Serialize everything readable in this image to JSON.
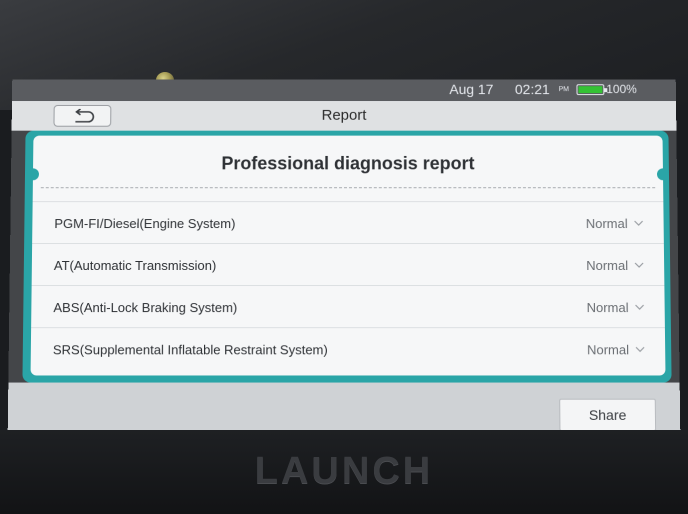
{
  "status": {
    "date": "Aug 17",
    "time": "02:21",
    "ampm": "PM",
    "battery": "100%"
  },
  "header": {
    "title": "Report"
  },
  "report": {
    "heading": "Professional diagnosis report",
    "systems": [
      {
        "name": "PGM-FI/Diesel(Engine System)",
        "status": "Normal"
      },
      {
        "name": "AT(Automatic Transmission)",
        "status": "Normal"
      },
      {
        "name": "ABS(Anti-Lock Braking System)",
        "status": "Normal"
      },
      {
        "name": "SRS(Supplemental Inflatable Restraint System)",
        "status": "Normal"
      }
    ]
  },
  "footer": {
    "share_label": "Share"
  },
  "device": {
    "brand": "LAUNCH"
  },
  "colors": {
    "accent": "#2aa5a7",
    "battery": "#34c234"
  }
}
